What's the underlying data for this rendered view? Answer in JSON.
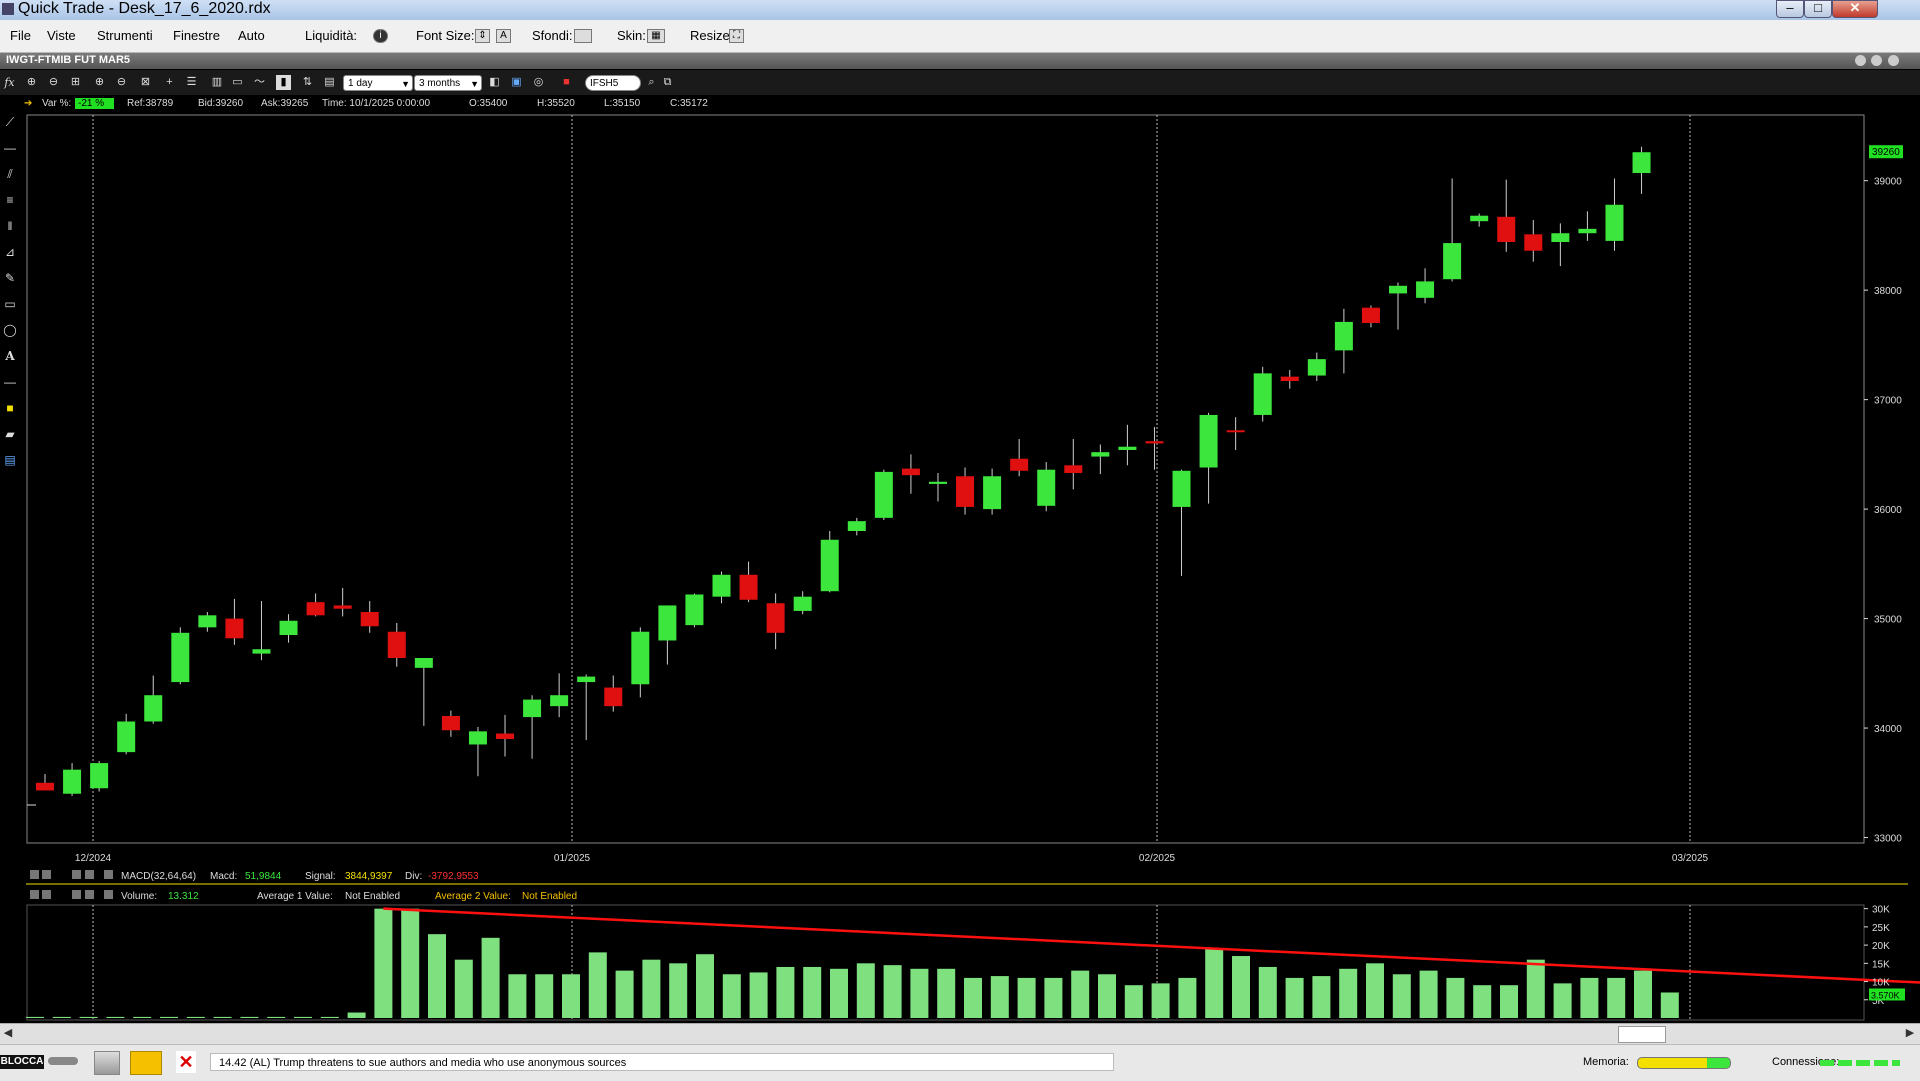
{
  "window": {
    "title": "Quick Trade - Desk_17_6_2020.rdx"
  },
  "menu": {
    "items": [
      "File",
      "Viste",
      "Strumenti",
      "Finestre",
      "Auto"
    ],
    "liquidita": "Liquidità:",
    "font_size": "Font Size:",
    "sfondi": "Sfondi:",
    "skin": "Skin:",
    "resize": "Resize:"
  },
  "doc": {
    "title": "IWGT-FTMIB FUT MAR5"
  },
  "toolbar": {
    "interval": "1 day",
    "range": "3 months",
    "symbol": "IFSH5",
    "fx_label": "fx"
  },
  "info": {
    "var_label": "Var %:",
    "var_value": "-21 %",
    "ref": "Ref:38789",
    "bid": "Bid:39260",
    "ask": "Ask:39265",
    "time": "Time:  10/1/2025 0:00:00",
    "open": "O:35400",
    "high": "H:35520",
    "low": "L:35150",
    "close": "C:35172"
  },
  "colors": {
    "up": "#3ce63c",
    "down": "#e01010",
    "volume": "#7fe07f",
    "trend": "#ff1010",
    "background": "#000000"
  },
  "left_tools": [
    "line-icon",
    "hline-icon",
    "channel-icon",
    "fib-icon",
    "vlines-icon",
    "gann-icon",
    "pen-icon",
    "rect-icon",
    "ellipse-icon",
    "text-icon",
    "separator-icon",
    "color-icon",
    "eraser-icon",
    "trash-icon"
  ],
  "chart_data": {
    "type": "candlestick",
    "y_ticks": [
      33000,
      34000,
      35000,
      36000,
      37000,
      38000,
      39000
    ],
    "ylim": [
      32950,
      39600
    ],
    "x_labels": [
      "12/2024",
      "01/2025",
      "02/2025",
      "03/2025"
    ],
    "last_price": "39260",
    "candles": [
      {
        "o": 33500,
        "h": 33580,
        "l": 33450,
        "c": 33430
      },
      {
        "o": 33400,
        "h": 33680,
        "l": 33380,
        "c": 33620
      },
      {
        "o": 33450,
        "h": 33700,
        "l": 33420,
        "c": 33680
      },
      {
        "o": 33780,
        "h": 34130,
        "l": 33760,
        "c": 34060
      },
      {
        "o": 34060,
        "h": 34480,
        "l": 34040,
        "c": 34300
      },
      {
        "o": 34420,
        "h": 34920,
        "l": 34400,
        "c": 34870
      },
      {
        "o": 34920,
        "h": 35060,
        "l": 34880,
        "c": 35030
      },
      {
        "o": 35000,
        "h": 35180,
        "l": 34760,
        "c": 34820
      },
      {
        "o": 34680,
        "h": 35160,
        "l": 34620,
        "c": 34720
      },
      {
        "o": 34850,
        "h": 35040,
        "l": 34780,
        "c": 34980
      },
      {
        "o": 35150,
        "h": 35230,
        "l": 35020,
        "c": 35030
      },
      {
        "o": 35120,
        "h": 35280,
        "l": 35020,
        "c": 35090
      },
      {
        "o": 35060,
        "h": 35160,
        "l": 34870,
        "c": 34930
      },
      {
        "o": 34880,
        "h": 34960,
        "l": 34560,
        "c": 34640
      },
      {
        "o": 34550,
        "h": 34620,
        "l": 34020,
        "c": 34640
      },
      {
        "o": 34110,
        "h": 34160,
        "l": 33920,
        "c": 33980
      },
      {
        "o": 33850,
        "h": 34010,
        "l": 33560,
        "c": 33970
      },
      {
        "o": 33950,
        "h": 34120,
        "l": 33740,
        "c": 33900
      },
      {
        "o": 34100,
        "h": 34300,
        "l": 33720,
        "c": 34260
      },
      {
        "o": 34200,
        "h": 34500,
        "l": 34100,
        "c": 34300
      },
      {
        "o": 34420,
        "h": 34490,
        "l": 33890,
        "c": 34470
      },
      {
        "o": 34370,
        "h": 34480,
        "l": 34150,
        "c": 34200
      },
      {
        "o": 34400,
        "h": 34920,
        "l": 34280,
        "c": 34880
      },
      {
        "o": 34800,
        "h": 35060,
        "l": 34580,
        "c": 35120
      },
      {
        "o": 34940,
        "h": 35230,
        "l": 34920,
        "c": 35220
      },
      {
        "o": 35200,
        "h": 35430,
        "l": 35140,
        "c": 35400
      },
      {
        "o": 35400,
        "h": 35520,
        "l": 35150,
        "c": 35172
      },
      {
        "o": 35140,
        "h": 35230,
        "l": 34720,
        "c": 34870
      },
      {
        "o": 35070,
        "h": 35250,
        "l": 35040,
        "c": 35200
      },
      {
        "o": 35250,
        "h": 35800,
        "l": 35240,
        "c": 35720
      },
      {
        "o": 35800,
        "h": 35920,
        "l": 35760,
        "c": 35890
      },
      {
        "o": 35920,
        "h": 36360,
        "l": 35900,
        "c": 36340
      },
      {
        "o": 36370,
        "h": 36500,
        "l": 36140,
        "c": 36310
      },
      {
        "o": 36230,
        "h": 36330,
        "l": 36070,
        "c": 36250
      },
      {
        "o": 36300,
        "h": 36380,
        "l": 35950,
        "c": 36020
      },
      {
        "o": 36000,
        "h": 36370,
        "l": 35950,
        "c": 36300
      },
      {
        "o": 36460,
        "h": 36640,
        "l": 36300,
        "c": 36350
      },
      {
        "o": 36030,
        "h": 36430,
        "l": 35980,
        "c": 36360
      },
      {
        "o": 36400,
        "h": 36640,
        "l": 36180,
        "c": 36330
      },
      {
        "o": 36480,
        "h": 36590,
        "l": 36320,
        "c": 36520
      },
      {
        "o": 36540,
        "h": 36770,
        "l": 36400,
        "c": 36570
      },
      {
        "o": 36620,
        "h": 36750,
        "l": 36360,
        "c": 36600
      },
      {
        "o": 36020,
        "h": 36360,
        "l": 35390,
        "c": 36350
      },
      {
        "o": 36380,
        "h": 36880,
        "l": 36050,
        "c": 36860
      },
      {
        "o": 36720,
        "h": 36840,
        "l": 36540,
        "c": 36710
      },
      {
        "o": 36860,
        "h": 37300,
        "l": 36800,
        "c": 37240
      },
      {
        "o": 37210,
        "h": 37270,
        "l": 37100,
        "c": 37170
      },
      {
        "o": 37220,
        "h": 37430,
        "l": 37170,
        "c": 37370
      },
      {
        "o": 37450,
        "h": 37830,
        "l": 37240,
        "c": 37710
      },
      {
        "o": 37840,
        "h": 37860,
        "l": 37660,
        "c": 37700
      },
      {
        "o": 37970,
        "h": 38070,
        "l": 37640,
        "c": 38040
      },
      {
        "o": 37930,
        "h": 38200,
        "l": 37880,
        "c": 38080
      },
      {
        "o": 38100,
        "h": 39020,
        "l": 38080,
        "c": 38430
      },
      {
        "o": 38630,
        "h": 38700,
        "l": 38580,
        "c": 38680
      },
      {
        "o": 38670,
        "h": 39010,
        "l": 38350,
        "c": 38440
      },
      {
        "o": 38510,
        "h": 38640,
        "l": 38260,
        "c": 38360
      },
      {
        "o": 38440,
        "h": 38610,
        "l": 38220,
        "c": 38520
      },
      {
        "o": 38520,
        "h": 38720,
        "l": 38450,
        "c": 38560
      },
      {
        "o": 38450,
        "h": 39020,
        "l": 38360,
        "c": 38780
      },
      {
        "o": 39070,
        "h": 39310,
        "l": 38880,
        "c": 39260
      }
    ],
    "macd": {
      "label": "MACD(32,64,64)",
      "macd_label": "Macd:",
      "macd_value": "51,9844",
      "signal_label": "Signal:",
      "signal_value": "3844,9397",
      "div_label": "Div:",
      "div_value": "-3792,9553"
    },
    "volume": {
      "label": "Volume:",
      "value": "13.312",
      "avg1_label": "Average 1 Value:",
      "avg1_value": "Not Enabled",
      "avg2_label": "Average 2 Value:",
      "avg2_value": "Not Enabled",
      "y_ticks": [
        "30K",
        "25K",
        "20K",
        "15K",
        "10K",
        "5K"
      ],
      "last_label": "3.570K",
      "ymax": 31000,
      "values": [
        300,
        300,
        300,
        300,
        300,
        300,
        300,
        300,
        300,
        300,
        300,
        300,
        1500,
        30000,
        30000,
        23000,
        16000,
        22000,
        12000,
        12000,
        12000,
        18000,
        13000,
        16000,
        15000,
        17500,
        12000,
        12500,
        14000,
        14000,
        13500,
        15000,
        14500,
        13500,
        13500,
        11000,
        11500,
        11000,
        11000,
        13000,
        12000,
        9000,
        9500,
        11000,
        19200,
        17000,
        14000,
        11000,
        11500,
        13500,
        15000,
        12000,
        13000,
        11000,
        9000,
        9000,
        16000,
        9500,
        11000,
        11000,
        13000,
        7000
      ],
      "trend": [
        {
          "i": 13,
          "v": 30000
        },
        {
          "i": 71,
          "v": 9500
        }
      ]
    }
  },
  "news": {
    "text": "14.42 (AL) Trump threatens to sue authors and media who use anonymous sources"
  },
  "status": {
    "lock": "BLOCCA",
    "memoria": "Memoria:",
    "connessione": "Connessione:"
  }
}
